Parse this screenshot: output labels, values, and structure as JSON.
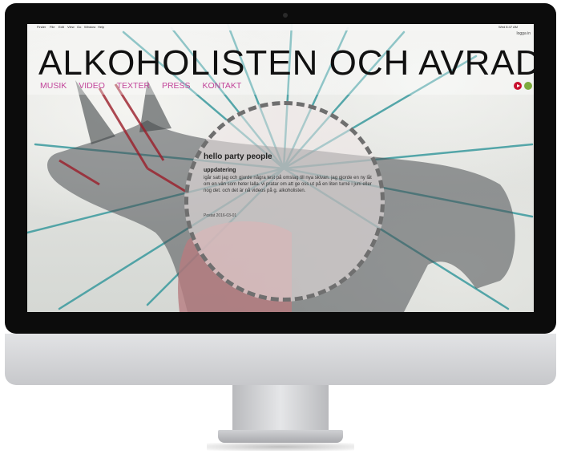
{
  "menubar": {
    "items": [
      "Finder",
      "File",
      "Edit",
      "View",
      "Go",
      "Window",
      "Help"
    ],
    "clock": "Wed 8:47 AM",
    "login_link": "logga in"
  },
  "site": {
    "title": "ALKOHOLISTEN OCH AVRADAN",
    "nav": [
      "MUSIK",
      "VIDEO",
      "TEXTER",
      "PRESS",
      "KONTAKT"
    ],
    "colors": {
      "nav": "#c2449a",
      "title": "#111111",
      "play": "#c8102e",
      "spotify": "#7dab3e"
    }
  },
  "post": {
    "title": "hello party people",
    "subtitle": "uppdatering",
    "body": "igår satt jag och gjorde några test på omslag till nya skivan. jag gjorde en ny låt om en vän som heter lalla. vi pratar om att ge oss ut på en liten turné i juni eller nog det. och det är nå videos på g. alkoholisten.",
    "date": "Postat 2016-03-01"
  },
  "icons": {
    "play": "play-icon",
    "spotify": "spotify-icon",
    "apple": "apple-icon"
  }
}
